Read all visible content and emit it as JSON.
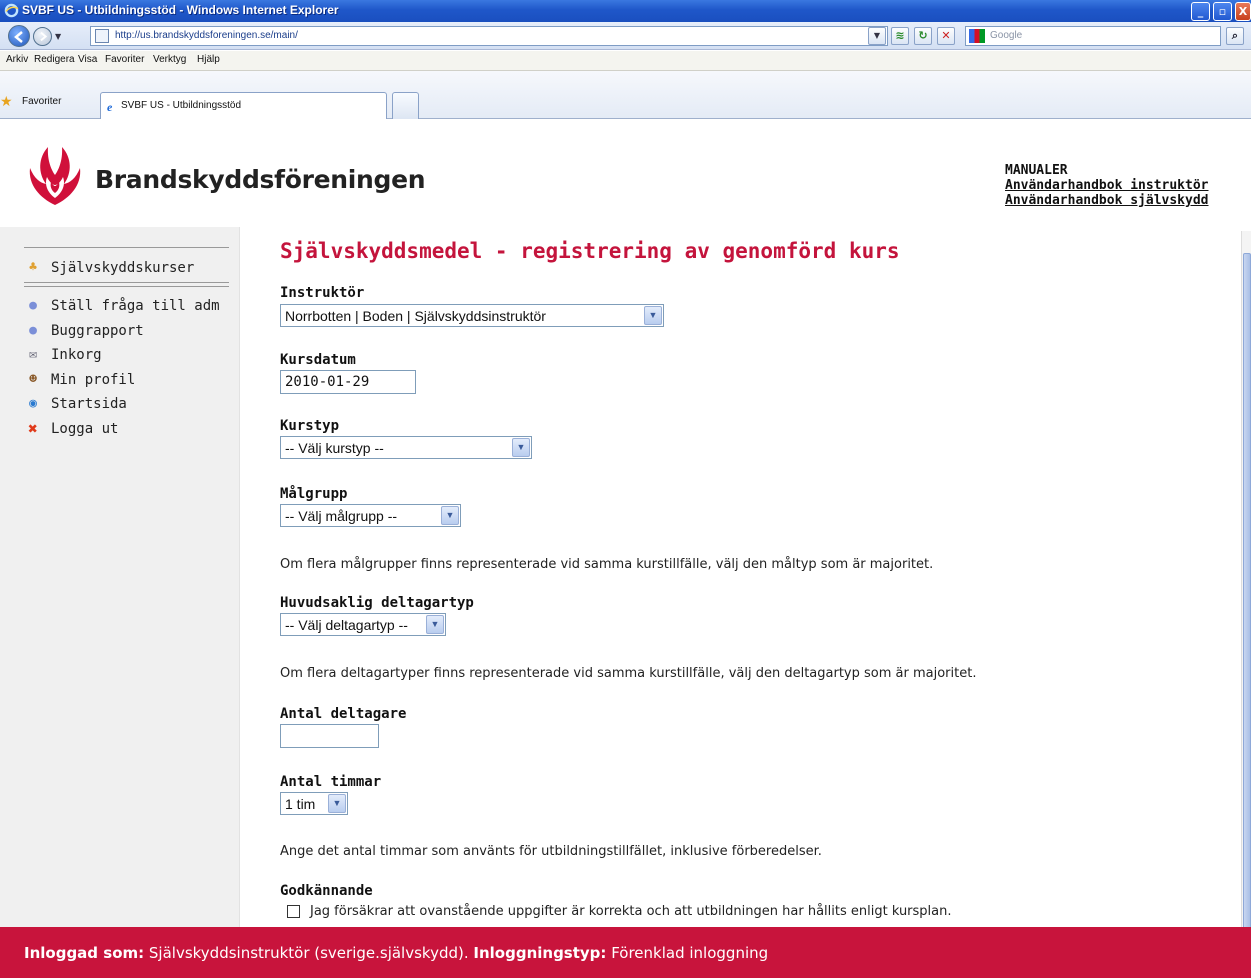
{
  "window": {
    "title": "SVBF US - Utbildningsstöd - Windows Internet Explorer",
    "url": "http://us.brandskyddsforeningen.se/main/",
    "search_placeholder": "Google"
  },
  "menu": [
    "Arkiv",
    "Redigera",
    "Visa",
    "Favoriter",
    "Verktyg",
    "Hjälp"
  ],
  "favorites": {
    "label": "Favoriter",
    "tab_title": "SVBF US - Utbildningsstöd"
  },
  "header": {
    "brand": "Brandskyddsföreningen",
    "manuals_heading": "MANUALER",
    "manual_links": [
      "Användarhandbok instruktör",
      "Användarhandbok självskydd"
    ]
  },
  "sidebar": {
    "items": [
      {
        "label": "Självskyddskurser",
        "icon": "people-icon"
      },
      {
        "label": "Ställ fråga till adm",
        "icon": "speech-bubble-icon"
      },
      {
        "label": "Buggrapport",
        "icon": "speech-bubble-icon"
      },
      {
        "label": "Inkorg",
        "icon": "envelope-icon"
      },
      {
        "label": "Min profil",
        "icon": "user-icon"
      },
      {
        "label": "Startsida",
        "icon": "globe-icon"
      },
      {
        "label": "Logga ut",
        "icon": "red-x-icon"
      }
    ]
  },
  "form": {
    "title": "Självskyddsmedel - registrering av genomförd kurs",
    "instructor": {
      "label": "Instruktör",
      "value": "Norrbotten | Boden | Självskyddsinstruktör"
    },
    "course_date": {
      "label": "Kursdatum",
      "value": "2010-01-29"
    },
    "course_type": {
      "label": "Kurstyp",
      "value": "-- Välj kurstyp --"
    },
    "target_group": {
      "label": "Målgrupp",
      "value": "-- Välj målgrupp --",
      "help": "Om flera målgrupper finns representerade vid samma kurstillfälle, välj den måltyp som är majoritet."
    },
    "participant_type": {
      "label": "Huvudsaklig deltagartyp",
      "value": "-- Välj deltagartyp --",
      "help": "Om flera deltagartyper finns representerade vid samma kurstillfälle, välj den deltagartyp som är majoritet."
    },
    "participants": {
      "label": "Antal deltagare",
      "value": ""
    },
    "hours": {
      "label": "Antal timmar",
      "value": "1 tim",
      "help": "Ange det antal timmar som använts för utbildningstillfället, inklusive förberedelser."
    },
    "approval": {
      "label": "Godkännande",
      "checkbox_text": "Jag försäkrar att ovanstående uppgifter är korrekta och att utbildningen har hållits enligt kursplan."
    }
  },
  "footer": {
    "logged_in_label": "Inloggad som:",
    "logged_in_value": "Självskyddsinstruktör (sverige.självskydd).",
    "login_type_label": "Inloggningstyp:",
    "login_type_value": "Förenklad inloggning"
  },
  "colors": {
    "accent": "#c8143c",
    "title": "#c4143c",
    "titlebar": "#1f57c9"
  }
}
